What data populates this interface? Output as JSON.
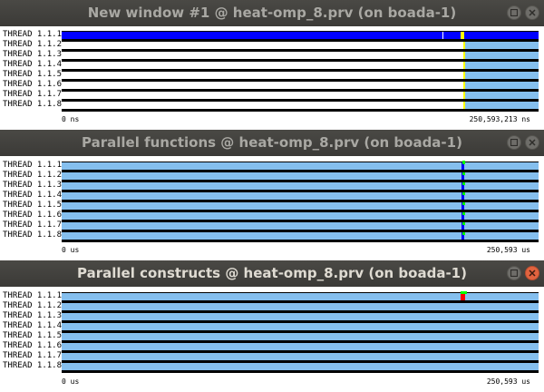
{
  "windows": [
    {
      "title": "New window #1 @ heat-omp_8.prv (on boada-1)",
      "threads": [
        "THREAD 1.1.1",
        "THREAD 1.1.2",
        "THREAD 1.1.3",
        "THREAD 1.1.4",
        "THREAD 1.1.5",
        "THREAD 1.1.6",
        "THREAD 1.1.7",
        "THREAD 1.1.8"
      ],
      "axis_start": "0 ns",
      "axis_end": "250,593,213 ns"
    },
    {
      "title": "Parallel functions @ heat-omp_8.prv (on boada-1)",
      "threads": [
        "THREAD 1.1.1",
        "THREAD 1.1.2",
        "THREAD 1.1.3",
        "THREAD 1.1.4",
        "THREAD 1.1.5",
        "THREAD 1.1.6",
        "THREAD 1.1.7",
        "THREAD 1.1.8"
      ],
      "axis_start": "0 us",
      "axis_end": "250,593 us"
    },
    {
      "title": "Parallel constructs @ heat-omp_8.prv (on boada-1)",
      "threads": [
        "THREAD 1.1.1",
        "THREAD 1.1.2",
        "THREAD 1.1.3",
        "THREAD 1.1.4",
        "THREAD 1.1.5",
        "THREAD 1.1.6",
        "THREAD 1.1.7",
        "THREAD 1.1.8"
      ],
      "axis_start": "0 us",
      "axis_end": "250,593 us"
    }
  ],
  "colors": {
    "titlebar": "#3c3b37",
    "running": "#85bfee",
    "idle": "#ffffff",
    "background": "#000000",
    "blue": "#0000ff",
    "yellow": "#ffff00",
    "green": "#00ff00",
    "red": "#ff0000",
    "close_active": "#e0633f"
  },
  "icons": [
    "maximize-icon",
    "close-icon"
  ]
}
